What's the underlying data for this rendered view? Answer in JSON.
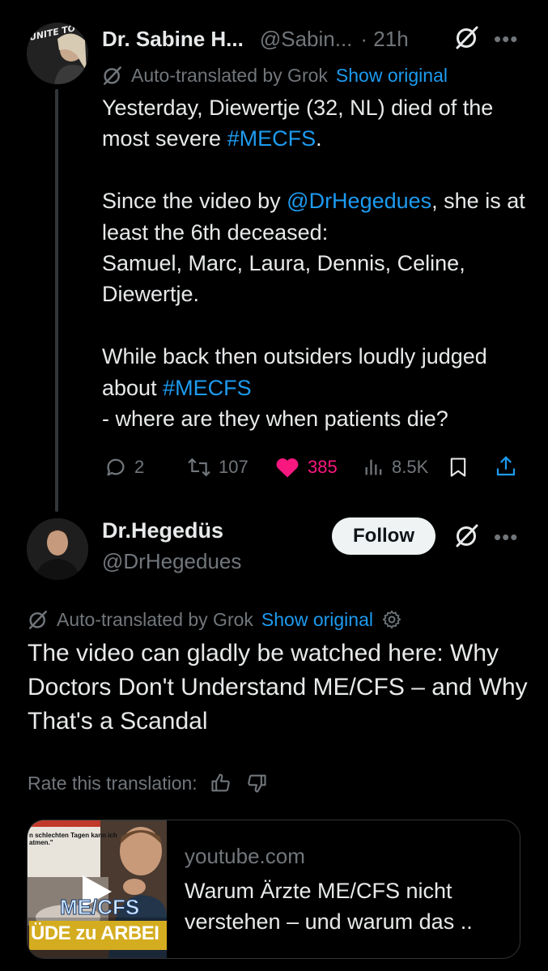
{
  "post1": {
    "author_name": "Dr. Sabine H...",
    "handle": "@Sabin...",
    "time": "· 21h",
    "avatar_text": "UNITE TO FIGHT",
    "translation": {
      "label": "Auto-translated by Grok",
      "show_original": "Show original"
    },
    "body": [
      {
        "text": "Yesterday, Diewertje (32, NL) died of the most severe "
      },
      {
        "text": "#MECFS",
        "link": true
      },
      {
        "text": ".\n\nSince the video by "
      },
      {
        "text": "@DrHegedues",
        "link": true
      },
      {
        "text": ", she is at least the 6th deceased:\nSamuel, Marc, Laura, Dennis, Celine, Diewertje.\n\nWhile back then outsiders loudly judged about "
      },
      {
        "text": "#MECFS",
        "link": true
      },
      {
        "text": "\n- where are they when patients die?"
      }
    ],
    "stats": {
      "replies": "2",
      "reposts": "107",
      "likes": "385",
      "views": "8.5K"
    },
    "like_color": "#f91880"
  },
  "post2": {
    "author_name": "Dr.Hegedüs",
    "handle": "@DrHegedues",
    "follow_label": "Follow",
    "translation": {
      "label": "Auto-translated by Grok",
      "show_original": "Show original"
    },
    "body": "The video can gladly be watched here: Why Doctors Don't Understand ME/CFS – and Why That's a Scandal",
    "rate_label": "Rate this translation:",
    "card": {
      "domain": "youtube.com",
      "title": "Warum Ärzte ME/CFS nicht\nverstehen – und warum das ..",
      "thumb_text1": "n schlechten Tagen kann ich\natmen.\"",
      "thumb_text2": "ME/CFS",
      "thumb_text3": "ÜDE zu ARBEI"
    }
  },
  "colors": {
    "background": "#000000",
    "text": "#e7e9ea",
    "secondary": "#71767b",
    "accent": "#1d9bf0"
  }
}
